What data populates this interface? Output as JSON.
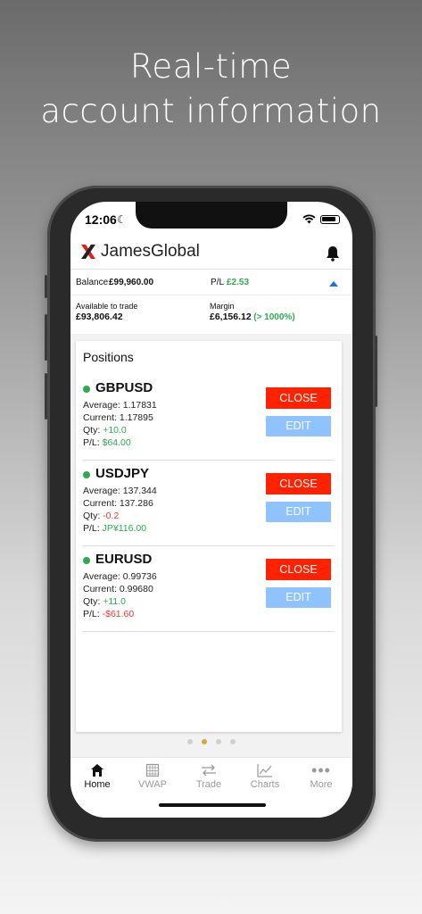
{
  "headline": {
    "line1": "Real-time",
    "line2": "account information"
  },
  "status_bar": {
    "time": "12:06"
  },
  "app": {
    "name": "JamesGlobal"
  },
  "account": {
    "balance_label": "Balance",
    "balance_value": "£99,960.00",
    "pl_label": "P/L",
    "pl_value": "£2.53",
    "available_label": "Available to trade",
    "available_value": "£93,806.42",
    "margin_label": "Margin",
    "margin_value": "£6,156.12",
    "margin_pct": "(> 1000%)"
  },
  "positions": {
    "title": "Positions",
    "close_label": "CLOSE",
    "edit_label": "EDIT",
    "average_label": "Average:",
    "current_label": "Current:",
    "qty_label": "Qty:",
    "pl_label": "P/L:",
    "items": [
      {
        "symbol": "GBPUSD",
        "average": "1.17831",
        "current": "1.17895",
        "qty": "+10.0",
        "pl": "$64.00"
      },
      {
        "symbol": "USDJPY",
        "average": "137.344",
        "current": "137.286",
        "qty": "-0.2",
        "pl": "JP¥116.00"
      },
      {
        "symbol": "EURUSD",
        "average": "0.99736",
        "current": "0.99680",
        "qty": "+11.0",
        "pl": "-$61.60"
      }
    ]
  },
  "pager": {
    "count": 4,
    "active_index": 1
  },
  "tabs": [
    {
      "label": "Home",
      "icon": "home-icon",
      "active": true
    },
    {
      "label": "VWAP",
      "icon": "grid-icon",
      "active": false
    },
    {
      "label": "Trade",
      "icon": "arrows-icon",
      "active": false
    },
    {
      "label": "Charts",
      "icon": "chart-icon",
      "active": false
    },
    {
      "label": "More",
      "icon": "more-icon",
      "active": false
    }
  ],
  "colors": {
    "close_button": "#ff2200",
    "edit_button": "#8ec3ff",
    "positive": "#2eaa4f",
    "negative": "#e53935",
    "brand_red": "#e0201a"
  }
}
